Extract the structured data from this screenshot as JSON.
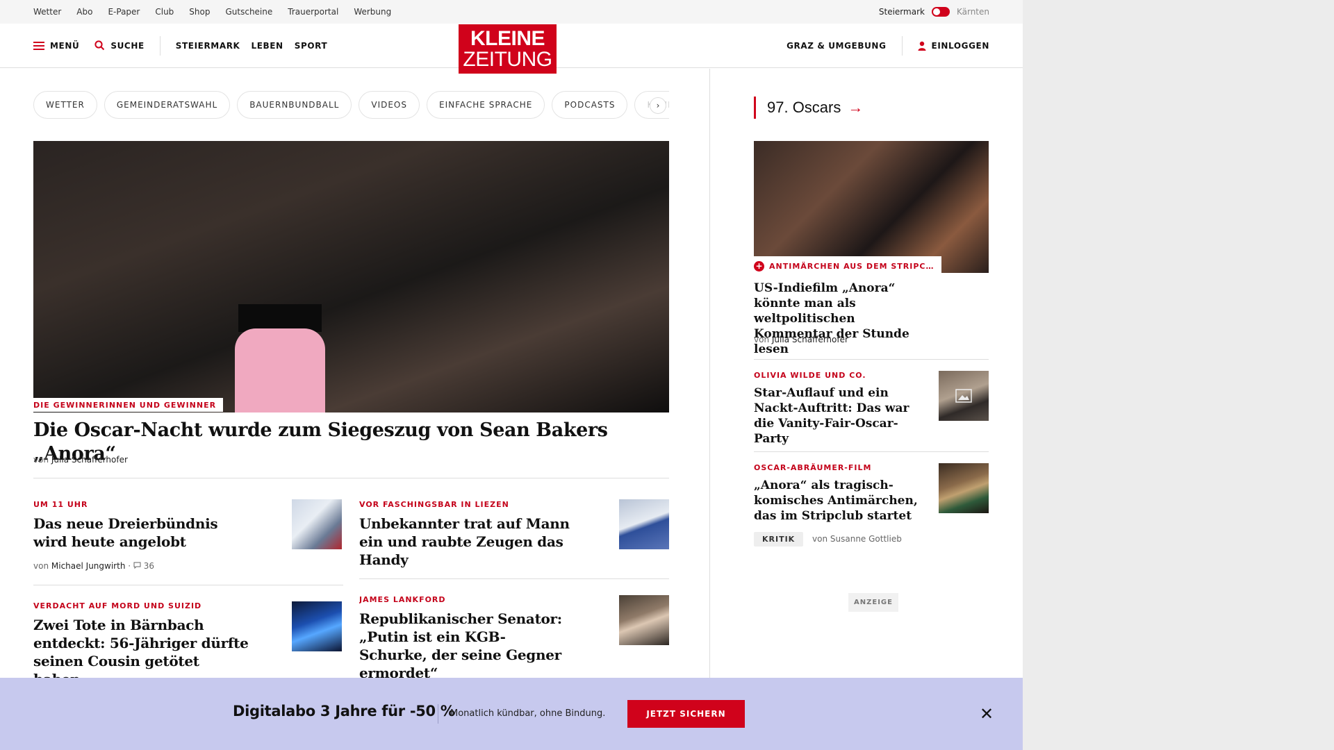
{
  "topbar": {
    "links": [
      "Wetter",
      "Abo",
      "E-Paper",
      "Club",
      "Shop",
      "Gutscheine",
      "Trauerportal",
      "Werbung"
    ],
    "region_active": "Steiermark",
    "region_inactive": "Kärnten"
  },
  "header": {
    "menu_label": "MENÜ",
    "search_label": "SUCHE",
    "nav": [
      "STEIERMARK",
      "LEBEN",
      "SPORT"
    ],
    "logo_line1": "KLEINE",
    "logo_line2": "ZEITUNG",
    "region_label": "GRAZ & UMGEBUNG",
    "login_label": "EINLOGGEN"
  },
  "pills": [
    "WETTER",
    "GEMEINDERATSWAHL",
    "BAUERNBUNDBALL",
    "VIDEOS",
    "EINFACHE SPRACHE",
    "PODCASTS",
    "KLEINE"
  ],
  "hero": {
    "kicker": "DIE GEWINNERINNEN UND GEWINNER",
    "title": "Die Oscar-Nacht wurde zum Siegeszug von Sean Bakers „Anora“",
    "author_prefix": "von",
    "author": "Julia Schafferhofer"
  },
  "teasers": [
    {
      "kicker": "UM 11 UHR",
      "title": "Das neue Dreierbündnis wird heute angelobt",
      "author_prefix": "von",
      "author": "Michael Jungwirth",
      "comments": "36"
    },
    {
      "kicker": "VOR FASCHINGSBAR IN LIEZEN",
      "title": "Unbekannter trat auf Mann ein und raubte Zeugen das Handy"
    },
    {
      "kicker": "VERDACHT AUF MORD UND SUIZID",
      "title": "Zwei Tote in Bärnbach entdeckt: 56-Jähriger dürfte seinen Cousin getötet haben"
    },
    {
      "kicker": "JAMES LANKFORD",
      "title": "Republikanischer Senator: „Putin ist ein KGB-Schurke, der seine Gegner ermordet“"
    }
  ],
  "sidebar": {
    "section_title": "97. Oscars",
    "lead": {
      "kicker": "ANTIMÄRCHEN AUS DEM STRIPC…",
      "title": "US-Indiefilm „Anora“ könnte man als weltpolitischen Kommentar der Stunde lesen",
      "author_prefix": "von",
      "author": "Julia Schafferhofer"
    },
    "items": [
      {
        "kicker": "OLIVIA WILDE UND CO.",
        "title": "Star-Auflauf und ein Nackt-Auftritt: Das war die Vanity-Fair-Oscar-Party"
      },
      {
        "kicker": "OSCAR-ABRÄUMER-FILM",
        "title": "„Anora“ als tragisch-komisches Antimärchen, das im Stripclub startet",
        "badge": "KRITIK",
        "author_prefix": "von",
        "author": "Susanne Gottlieb"
      }
    ],
    "ad_label": "ANZEIGE"
  },
  "promo": {
    "title": "Digitalabo 3 Jahre für -50 %",
    "subtitle": "Monatlich kündbar, ohne Bindung.",
    "button": "JETZT SICHERN"
  },
  "colors": {
    "brand_red": "#d0021b",
    "promo_bg": "#c7c9ee"
  }
}
